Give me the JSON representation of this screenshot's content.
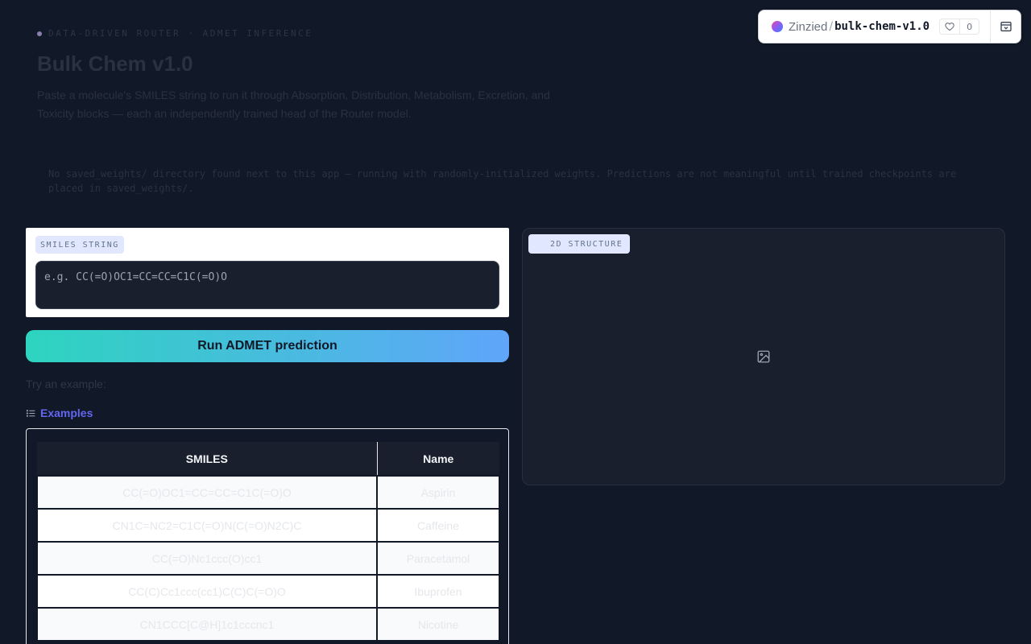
{
  "space": {
    "owner": "Zinzied",
    "separator": "/",
    "name": "bulk-chem-v1.0",
    "likes": "0"
  },
  "header": {
    "eyebrow": "DATA-DRIVEN ROUTER · ADMET INFERENCE",
    "title": "Bulk Chem v1.0",
    "description": "Paste a molecule's SMILES string to run it through Absorption, Distribution, Metabolism, Excretion, and Toxicity blocks — each an independently trained head of the Router model.",
    "warning": "No saved_weights/ directory found next to this app — running with randomly-initialized weights. Predictions are not meaningful until trained checkpoints are placed in saved_weights/."
  },
  "smiles": {
    "label": "SMILES STRING",
    "placeholder": "e.g. CC(=O)OC1=CC=CC=C1C(=O)O",
    "value": ""
  },
  "run_button": "Run ADMET prediction",
  "try_example": "Try an example:",
  "examples": {
    "label": "Examples",
    "headers": [
      "SMILES",
      "Name"
    ],
    "rows": [
      {
        "smiles": "CC(=O)OC1=CC=CC=C1C(=O)O",
        "name": "Aspirin"
      },
      {
        "smiles": "CN1C=NC2=C1C(=O)N(C(=O)N2C)C",
        "name": "Caffeine"
      },
      {
        "smiles": "CC(=O)Nc1ccc(O)cc1",
        "name": "Paracetamol"
      },
      {
        "smiles": "CC(C)Cc1ccc(cc1)C(C)C(=O)O",
        "name": "Ibuprofen"
      },
      {
        "smiles": "CN1CCC[C@H]1c1cccnc1",
        "name": "Nicotine"
      }
    ]
  },
  "structure": {
    "label": "2D STRUCTURE",
    "icon": "image-icon"
  },
  "colors": {
    "background": "#111827",
    "accent_start": "#2dd4bf",
    "accent_end": "#60a5fa",
    "link": "#6366f1"
  }
}
